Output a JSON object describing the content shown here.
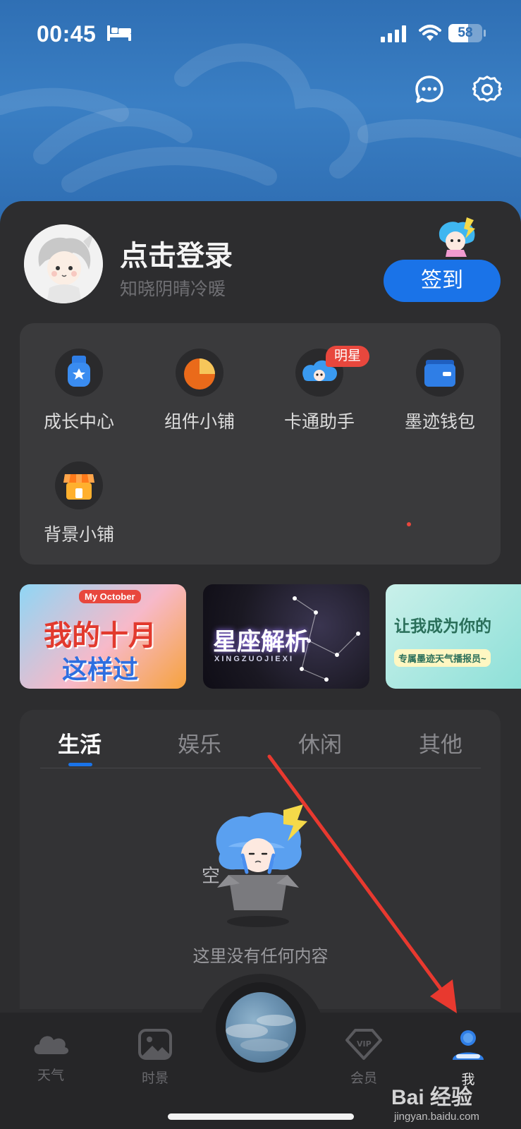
{
  "status_bar": {
    "time": "00:45",
    "battery": "58",
    "battery_level": 0.58
  },
  "header": {
    "message_icon": "chat-bubble-icon",
    "settings_icon": "gear-icon"
  },
  "profile": {
    "login_title": "点击登录",
    "subtitle": "知晓阴晴冷暖",
    "signin_label": "签到"
  },
  "features": [
    {
      "label": "成长中心",
      "icon": "medal-icon"
    },
    {
      "label": "组件小铺",
      "icon": "pie-chart-icon"
    },
    {
      "label": "卡通助手",
      "icon": "cartoon-cloud-icon",
      "badge": "明星"
    },
    {
      "label": "墨迹钱包",
      "icon": "wallet-icon"
    },
    {
      "label": "背景小铺",
      "icon": "shop-icon"
    }
  ],
  "banners": [
    {
      "line1": "我的十月",
      "line2": "这样过",
      "tag": "My October"
    },
    {
      "title": "星座解析",
      "subtitle": "XINGZUOJIEXI"
    },
    {
      "title": "让我成为你的",
      "subtitle": "专属墨迹天气播报员~"
    }
  ],
  "tabs": [
    "生活",
    "娱乐",
    "休闲",
    "其他"
  ],
  "empty": {
    "mascot_text": "空",
    "message": "这里没有任何内容"
  },
  "nav": [
    {
      "label": "天气",
      "icon": "cloud-icon"
    },
    {
      "label": "时景",
      "icon": "image-icon"
    },
    {
      "label": "会员",
      "icon": "vip-diamond-icon"
    },
    {
      "label": "我",
      "icon": "person-icon"
    }
  ],
  "watermark": {
    "brand": "Bai 经验",
    "url": "jingyan.baidu.com"
  },
  "colors": {
    "accent": "#1a73e8",
    "badge": "#e8473d",
    "hero": "#2f6fb4",
    "sheet": "#2d2d2f"
  }
}
